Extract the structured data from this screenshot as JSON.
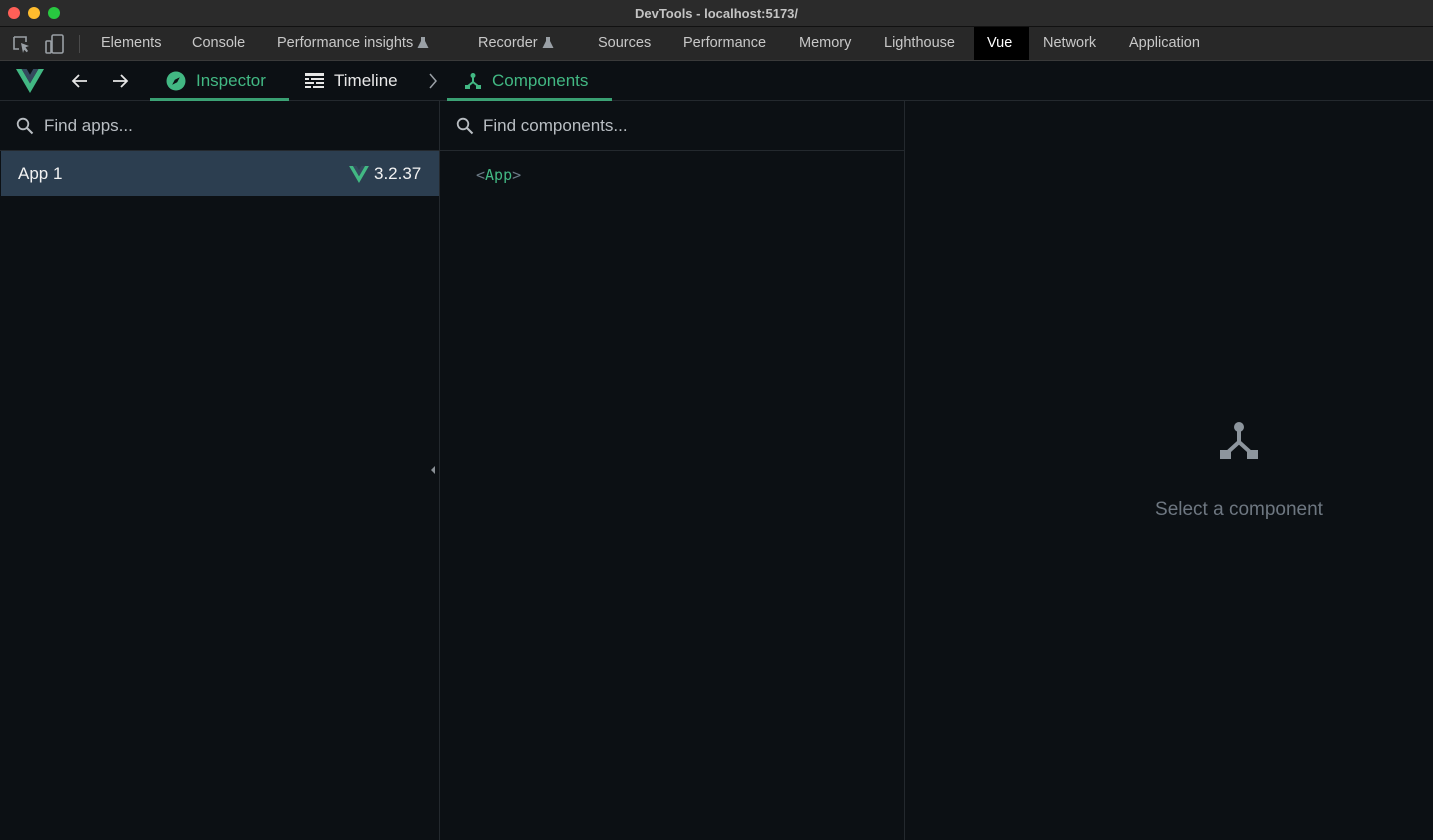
{
  "window": {
    "title": "DevTools - localhost:5173/"
  },
  "devtools_tabs": [
    {
      "label": "Elements"
    },
    {
      "label": "Console"
    },
    {
      "label": "Performance insights"
    },
    {
      "label": "Recorder"
    },
    {
      "label": "Sources"
    },
    {
      "label": "Performance"
    },
    {
      "label": "Memory"
    },
    {
      "label": "Lighthouse"
    },
    {
      "label": "Vue",
      "active": true
    },
    {
      "label": "Network"
    },
    {
      "label": "Application"
    }
  ],
  "vue_toolbar": {
    "tabs": [
      {
        "label": "Inspector",
        "icon": "compass-icon",
        "active": true
      },
      {
        "label": "Timeline",
        "icon": "timeline-icon"
      }
    ],
    "breadcrumb": {
      "label": "Components",
      "icon": "component-tree-icon",
      "active": true
    }
  },
  "apps_pane": {
    "search_placeholder": "Find apps...",
    "apps": [
      {
        "name": "App 1",
        "vue_version": "3.2.37",
        "selected": true
      }
    ]
  },
  "components_pane": {
    "search_placeholder": "Find components...",
    "tree": [
      {
        "open": "<",
        "name": "App",
        "close": ">"
      }
    ]
  },
  "details_pane": {
    "empty_icon": "component-tree-icon",
    "empty_text": "Select a component"
  },
  "colors": {
    "accent": "#42b883",
    "selected_row": "#2c3e50",
    "background": "#0c1014"
  }
}
